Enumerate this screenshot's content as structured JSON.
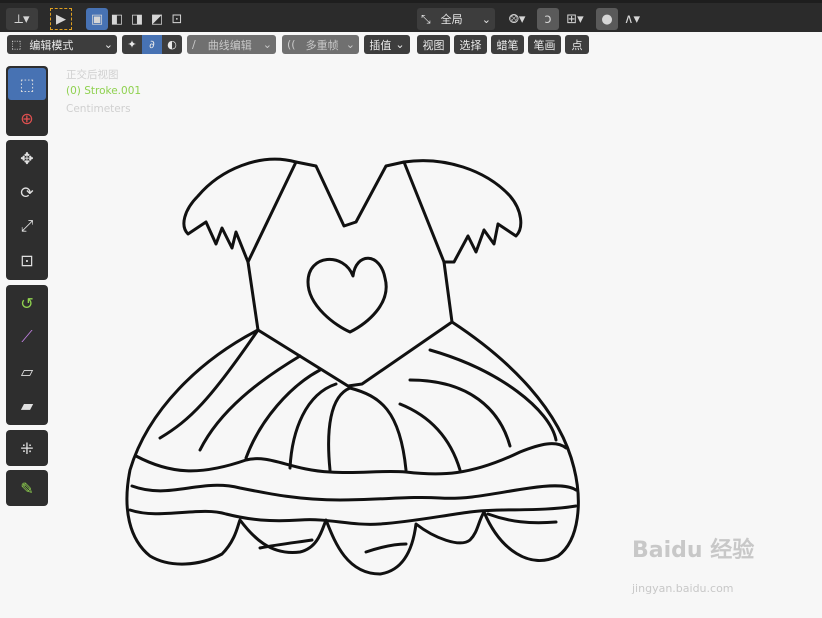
{
  "header": {
    "pivot_label": "全局",
    "mode_label": "编辑模式",
    "curve_edit_label": "曲线编辑",
    "multiframe_label": "多重帧",
    "interpolate_label": "插值",
    "menu": [
      "视图",
      "选择",
      "蜡笔",
      "笔画",
      "点"
    ]
  },
  "overlay": {
    "view_name": "正交后视图",
    "object_name": "(0) Stroke.001",
    "units": "Centimeters"
  },
  "toolbar": {
    "tools": [
      "select-box-icon",
      "cursor-icon",
      "move-icon",
      "rotate-icon",
      "scale-icon",
      "transform-icon",
      "bend-icon",
      "shear-icon",
      "to-sphere-icon",
      "transform-fill-icon",
      "extrude-icon",
      "draw-icon"
    ]
  },
  "watermark": {
    "brand": "Baidu 经验",
    "url": "jingyan.baidu.com"
  },
  "colors": {
    "accent": "#4772b3",
    "toolbar_bg": "#2e2e2e",
    "viewport_bg": "#f7f7f7",
    "overlay_green": "#8fd14f"
  }
}
